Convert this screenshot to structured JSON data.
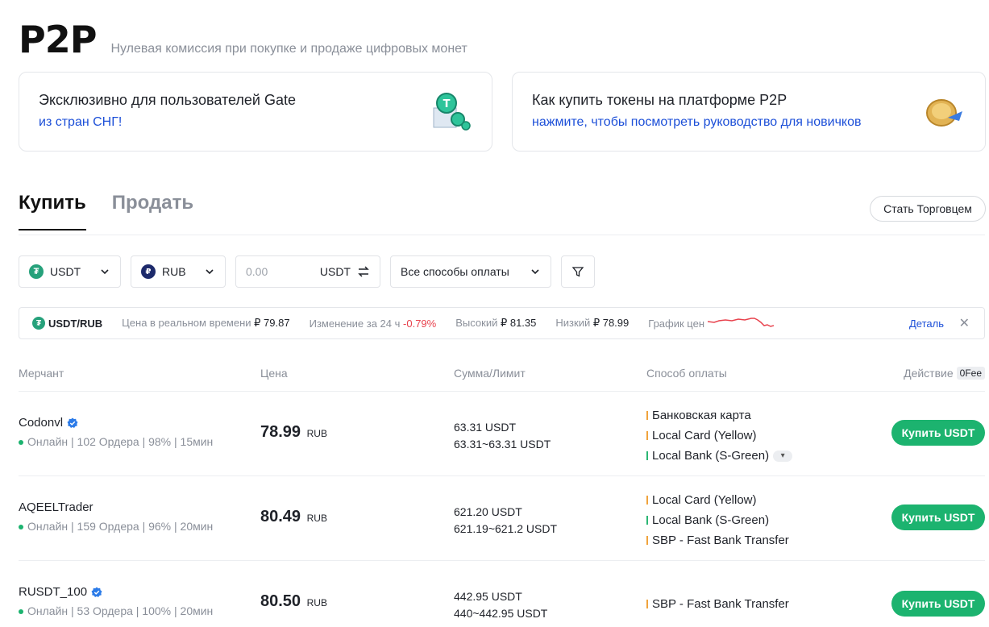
{
  "header": {
    "title": "P2P",
    "subtitle": "Нулевая комиссия при покупке и продаже цифровых монет"
  },
  "banners": [
    {
      "title": "Эксклюзивно для пользователей Gate",
      "link": "из стран СНГ!"
    },
    {
      "title": "Как купить токены на платформе P2P",
      "link": "нажмите, чтобы посмотреть руководство для новичков"
    }
  ],
  "tabs": {
    "buy": "Купить",
    "sell": "Продать"
  },
  "become_merchant": "Стать Торговцем",
  "filters": {
    "coin": "USDT",
    "fiat": "RUB",
    "amount_placeholder": "0.00",
    "amount_currency": "USDT",
    "payment": "Все способы оплаты"
  },
  "ticker": {
    "pair": "USDT/RUB",
    "realtime_label": "Цена в реальном времени",
    "realtime_value": "₽ 79.87",
    "change_label": "Изменение за 24 ч",
    "change_value": "-0.79%",
    "high_label": "Высокий",
    "high_value": "₽ 81.35",
    "low_label": "Низкий",
    "low_value": "₽ 78.99",
    "chart_label": "График цен",
    "detail": "Деталь",
    "line_color": "#e8424d"
  },
  "table": {
    "headers": {
      "merchant": "Мерчант",
      "price": "Цена",
      "amount": "Сумма/Лимит",
      "payment": "Способ оплаты",
      "action": "Действие",
      "fee_badge": "0Fee"
    },
    "rows": [
      {
        "name": "Codonvl",
        "stats": "Онлайн | 102 Ордера | 98% | 15мин",
        "price": "78.99",
        "currency": "RUB",
        "amount": "63.31 USDT",
        "limit": "63.31~63.31 USDT",
        "payments": [
          "Банковская карта",
          "Local Card (Yellow)",
          "Local Bank (S-Green)"
        ],
        "buy": "Купить USDT"
      },
      {
        "name": "AQEELTrader",
        "stats": "Онлайн | 159 Ордера | 96% | 20мин",
        "price": "80.49",
        "currency": "RUB",
        "amount": "621.20 USDT",
        "limit": "621.19~621.2 USDT",
        "payments": [
          "Local Card (Yellow)",
          "Local Bank (S-Green)",
          "SBP - Fast Bank Transfer"
        ],
        "buy": "Купить USDT"
      },
      {
        "name": "RUSDT_100",
        "stats": "Онлайн | 53 Ордера | 100% | 20мин",
        "price": "80.50",
        "currency": "RUB",
        "amount": "442.95 USDT",
        "limit": "440~442.95 USDT",
        "payments": [
          "SBP - Fast Bank Transfer"
        ],
        "buy": "Купить USDT"
      }
    ]
  },
  "colors": {
    "accent_green": "#1cb36f",
    "link_blue": "#1c4fd8",
    "negative": "#e8424d"
  }
}
